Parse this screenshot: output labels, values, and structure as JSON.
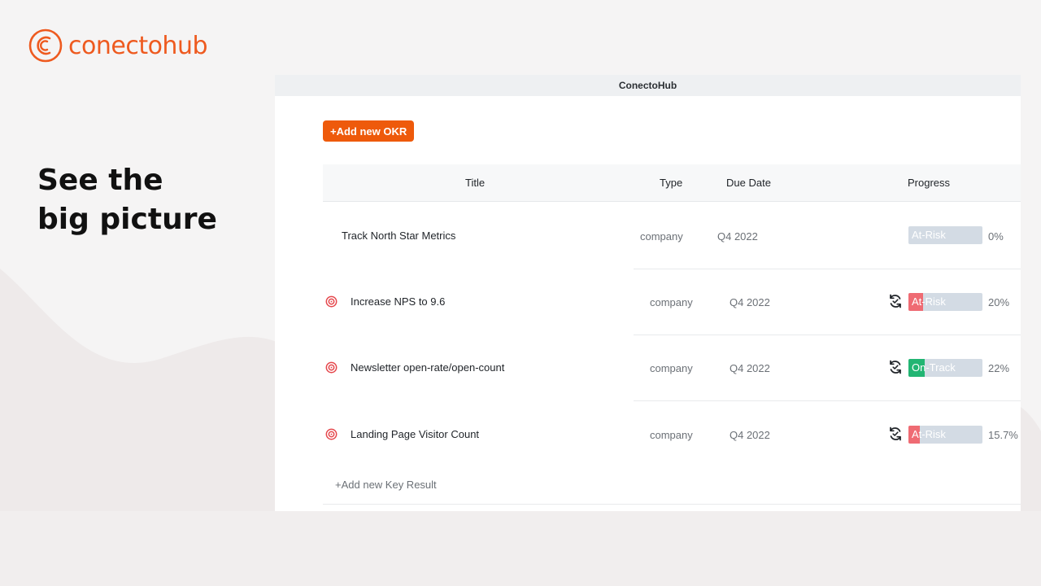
{
  "brand": {
    "name": "conectohub",
    "accent": "#ee5a1f"
  },
  "headline": {
    "line1": "See the",
    "line2": "big picture"
  },
  "window": {
    "title": "ConectoHub"
  },
  "actions": {
    "add_okr": "+Add new OKR",
    "add_key_result": "+Add new Key Result"
  },
  "table": {
    "headers": {
      "title": "Title",
      "type": "Type",
      "due": "Due Date",
      "progress": "Progress"
    },
    "rows": [
      {
        "title": "Track North Star Metrics",
        "type": "company",
        "due": "Q4 2022",
        "status": "At-Risk",
        "percent": "0%",
        "progress": 0,
        "status_color": "#ef6b73",
        "has_target_icon": false,
        "has_sync_icon": false
      },
      {
        "title": "Increase NPS to 9.6",
        "type": "company",
        "due": "Q4 2022",
        "status": "At-Risk",
        "percent": "20%",
        "progress": 0.2,
        "status_color": "#ef6b73",
        "has_target_icon": true,
        "has_sync_icon": true
      },
      {
        "title": "Newsletter open-rate/open-count",
        "type": "company",
        "due": "Q4 2022",
        "status": "On-Track",
        "percent": "22%",
        "progress": 0.22,
        "status_color": "#22b573",
        "has_target_icon": true,
        "has_sync_icon": true
      },
      {
        "title": "Landing Page Visitor Count",
        "type": "company",
        "due": "Q4 2022",
        "status": "At-Risk",
        "percent": "15.7%",
        "progress": 0.157,
        "status_color": "#ef6b73",
        "has_target_icon": true,
        "has_sync_icon": true
      }
    ]
  },
  "icons": {
    "target": "target-icon",
    "sync": "sync-icon",
    "logo": "conectohub-logo-icon"
  }
}
